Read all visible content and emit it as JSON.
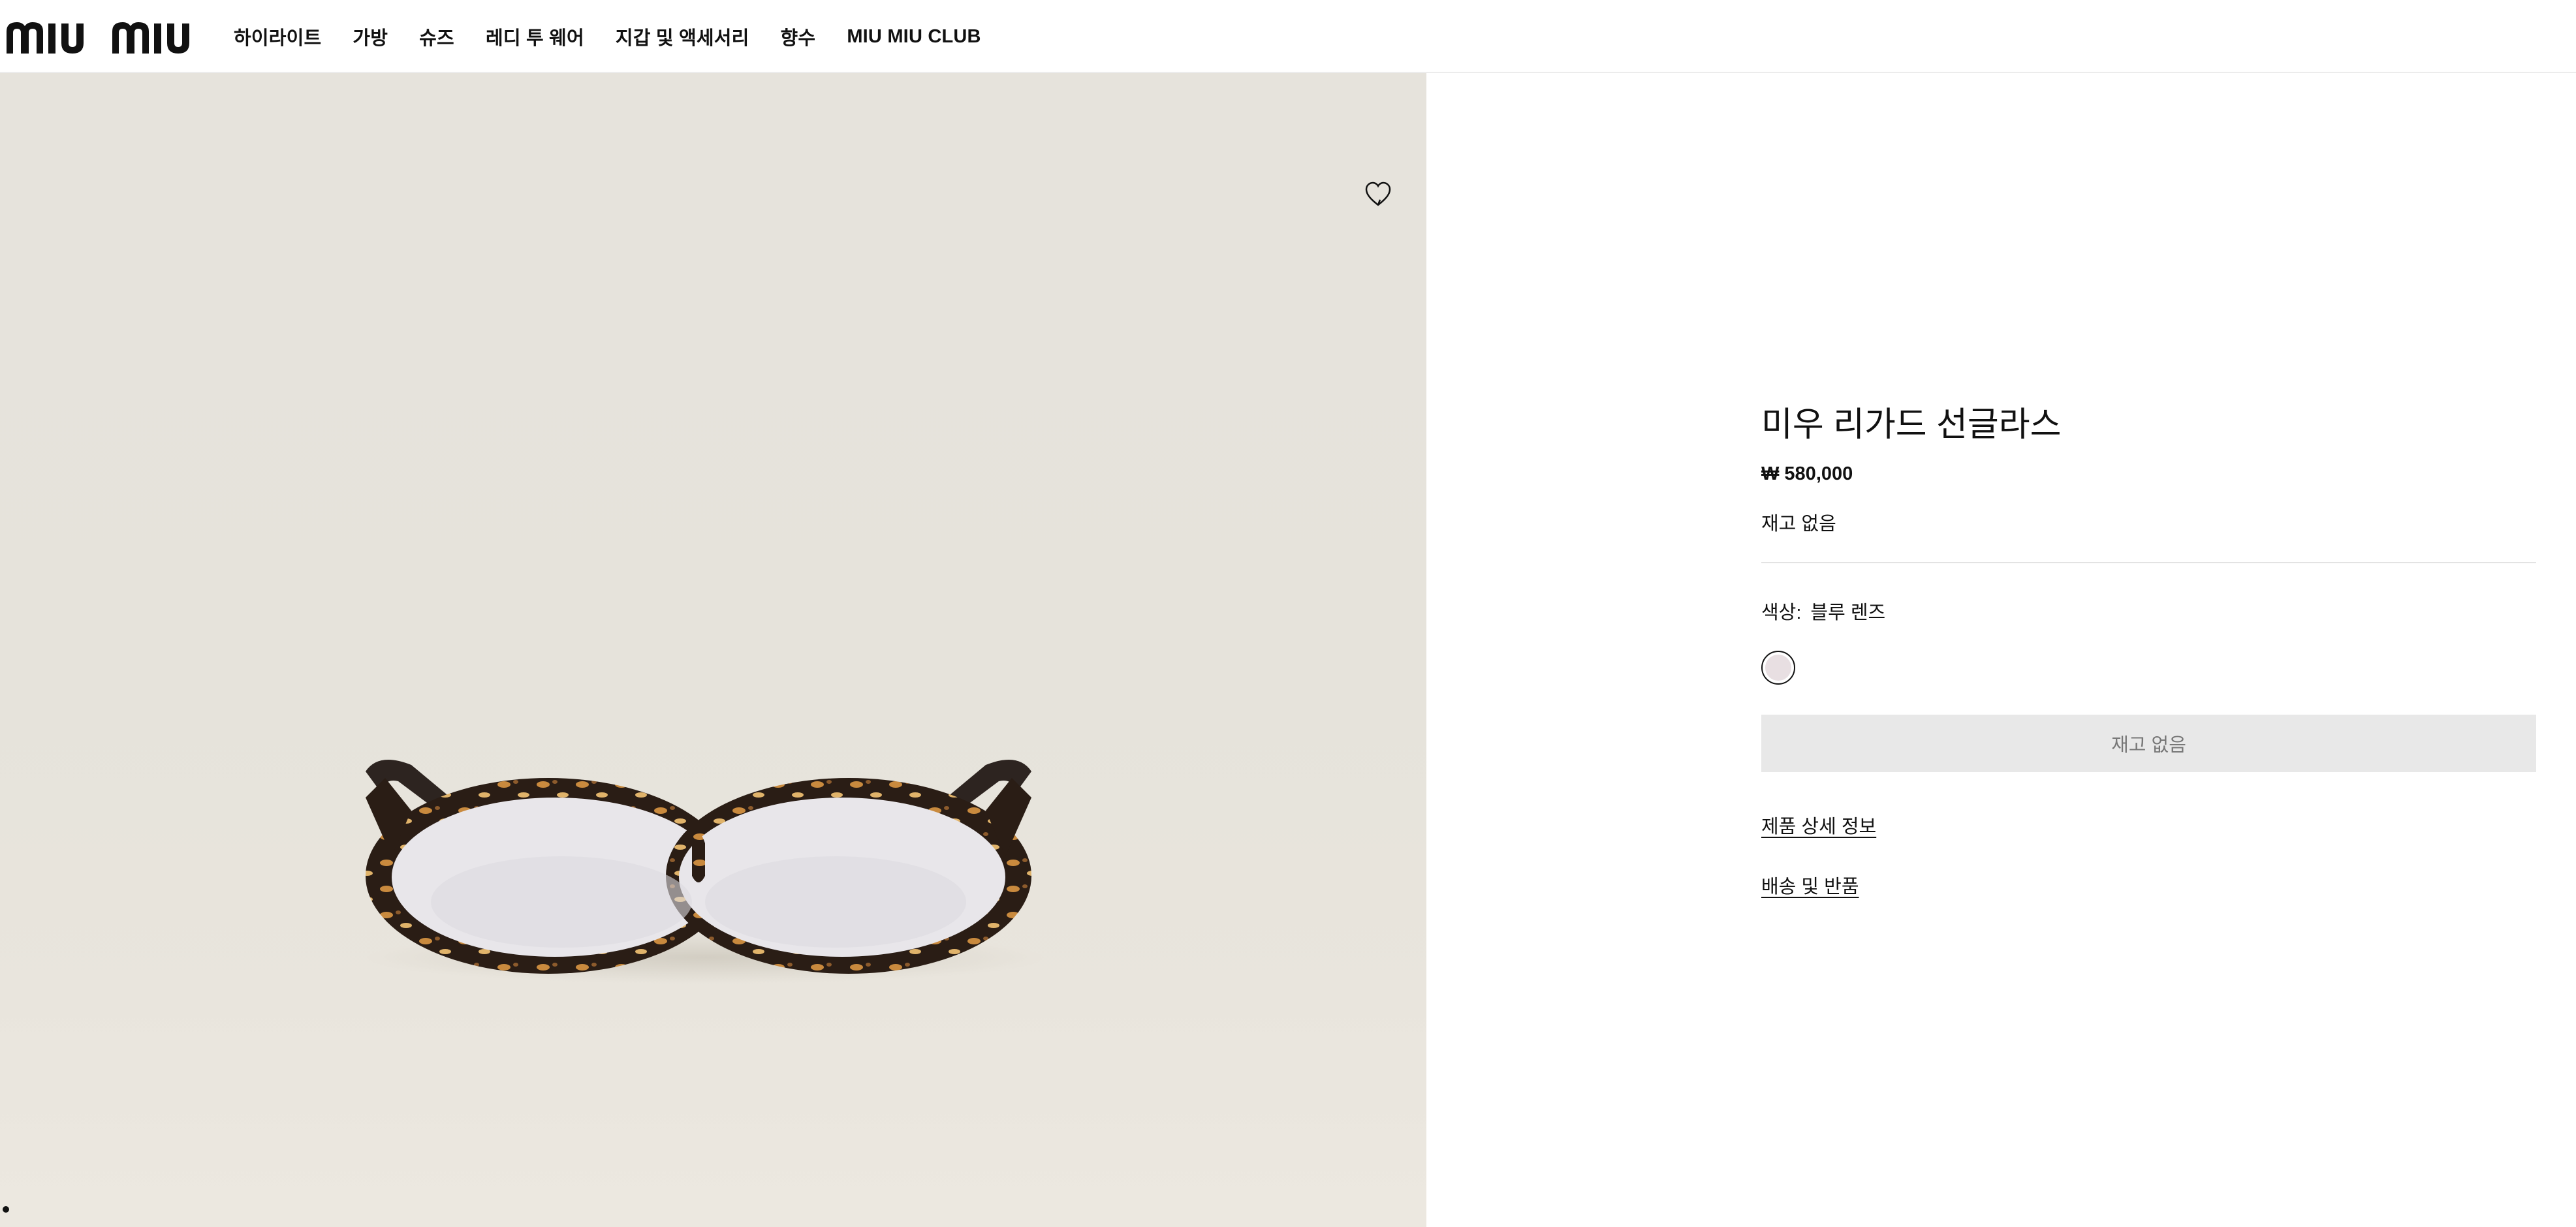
{
  "brand": {
    "logo_text": "miu miu"
  },
  "nav": {
    "items": [
      "하이라이트",
      "가방",
      "슈즈",
      "레디 투 웨어",
      "지갑 및 액세서리",
      "향수",
      "MIU MIU CLUB"
    ]
  },
  "gallery": {
    "slide_count": 3,
    "active_slide": 1
  },
  "product": {
    "title": "미우 리가드 선글라스",
    "price": "₩ 580,000",
    "availability": "재고 없음",
    "color_label": "색상:",
    "color_value": "블루 렌즈",
    "swatch_color": "#e8dfe2",
    "primary_button": "재고 없음",
    "details_link": "제품 상세 정보",
    "shipping_link": "배송 및 반품"
  },
  "colors": {
    "image_background": "#e6e2da",
    "tortoise_dark": "#2b1e17",
    "tortoise_light": "#d9a65c",
    "button_disabled_bg": "#e8e8e8",
    "button_disabled_text": "#777777"
  }
}
